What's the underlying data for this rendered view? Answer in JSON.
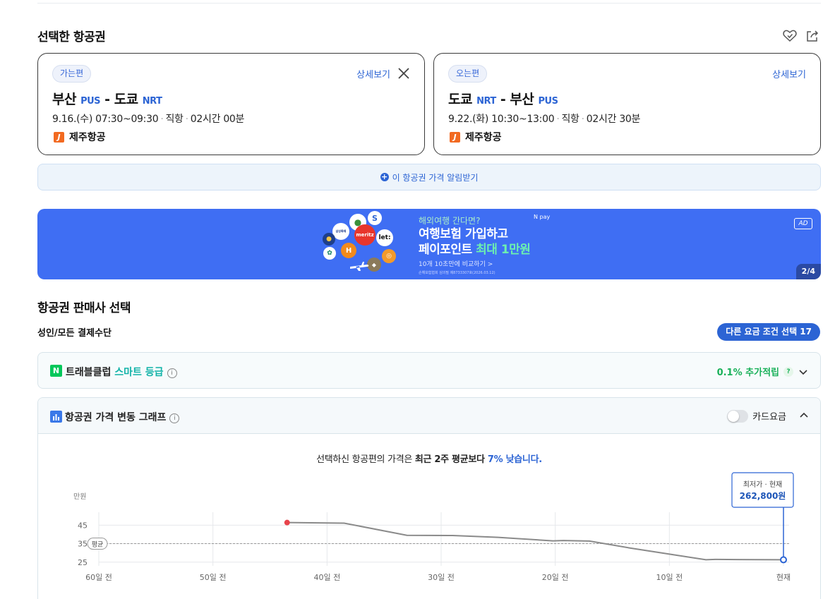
{
  "selected": {
    "title": "선택한 항공권",
    "icons": [
      "heart-check-icon",
      "share-icon"
    ]
  },
  "outbound": {
    "badge": "가는편",
    "detail": "상세보기",
    "from_city": "부산",
    "from_code": "PUS",
    "dash": "-",
    "to_city": "도쿄",
    "to_code": "NRT",
    "date_time": "9.16.(수) 07:30~09:30",
    "type": "직항",
    "duration": "02시간 00분",
    "airline": "제주항공",
    "dot": "·"
  },
  "inbound": {
    "badge": "오는편",
    "detail": "상세보기",
    "from_city": "도쿄",
    "from_code": "NRT",
    "dash": "-",
    "to_city": "부산",
    "to_code": "PUS",
    "date_time": "9.22.(화) 10:30~13:00",
    "type": "직항",
    "duration": "02시간 30분",
    "airline": "제주항공",
    "dot": "·"
  },
  "alert": {
    "label": "이 항공권 가격 알림받기"
  },
  "ad": {
    "line1": "해외여행 간다면?",
    "line2": "여행보험 가입하고",
    "line3_a": "페이포인트 ",
    "line3_b": "최대 1만원",
    "line4": "10개 10초만에 비교하기 >",
    "tiny": "손해보험협회 심의필 제8733307호(2026.03.12)",
    "pay": "N pay",
    "ad_label": "AD",
    "page": "2/4",
    "logo_texts": [
      "meritz",
      "let:",
      "H",
      "삼성화재"
    ]
  },
  "seller": {
    "title": "항공권 판매사 선택",
    "pay_method": "성인/모든 결제수단",
    "fare_btn": "다른 요금 조건 선택 17"
  },
  "club": {
    "n": "N",
    "name": "트래블클럽 ",
    "grade": "스마트 등급",
    "info": "i",
    "reward": "0.1% 추가적립",
    "q": "?"
  },
  "graph": {
    "title": "항공권 가격 변동 그래프",
    "info": "i",
    "card_price": "카드요금",
    "summary_a": "선택하신 항공편의 가격은 ",
    "summary_b": "최근 2주 평균보다 ",
    "summary_c": "7% 낮습니다.",
    "tooltip_label": "최저가 · 현재",
    "tooltip_value": "262,800원",
    "avg_label": "평균"
  },
  "chart_data": {
    "type": "line",
    "ylabel": "만원",
    "yticks": [
      45,
      35,
      25
    ],
    "ylim": [
      23,
      52
    ],
    "xlim": [
      60,
      0
    ],
    "xticks": [
      {
        "x": 60,
        "label": "60일 전"
      },
      {
        "x": 50,
        "label": "50일 전"
      },
      {
        "x": 40,
        "label": "40일 전"
      },
      {
        "x": 30,
        "label": "30일 전"
      },
      {
        "x": 20,
        "label": "20일 전"
      },
      {
        "x": 10,
        "label": "10일 전"
      },
      {
        "x": 0,
        "label": "현재"
      }
    ],
    "average": 35,
    "series": [
      {
        "x": [
          43.5,
          38.5,
          33,
          29,
          25,
          20.2,
          19.3,
          17,
          13.5,
          6.8,
          6,
          4,
          0
        ],
        "y": [
          46.4,
          46.1,
          39.5,
          39.4,
          38.4,
          36.5,
          36.7,
          36.4,
          32.7,
          26.3,
          26.5,
          26.4,
          26.28
        ]
      }
    ],
    "start_point": {
      "x": 43.5,
      "y": 46.4,
      "color": "#e8434b"
    },
    "end_point": {
      "x": 0,
      "y": 26.28,
      "color": "#2c64d4"
    }
  }
}
